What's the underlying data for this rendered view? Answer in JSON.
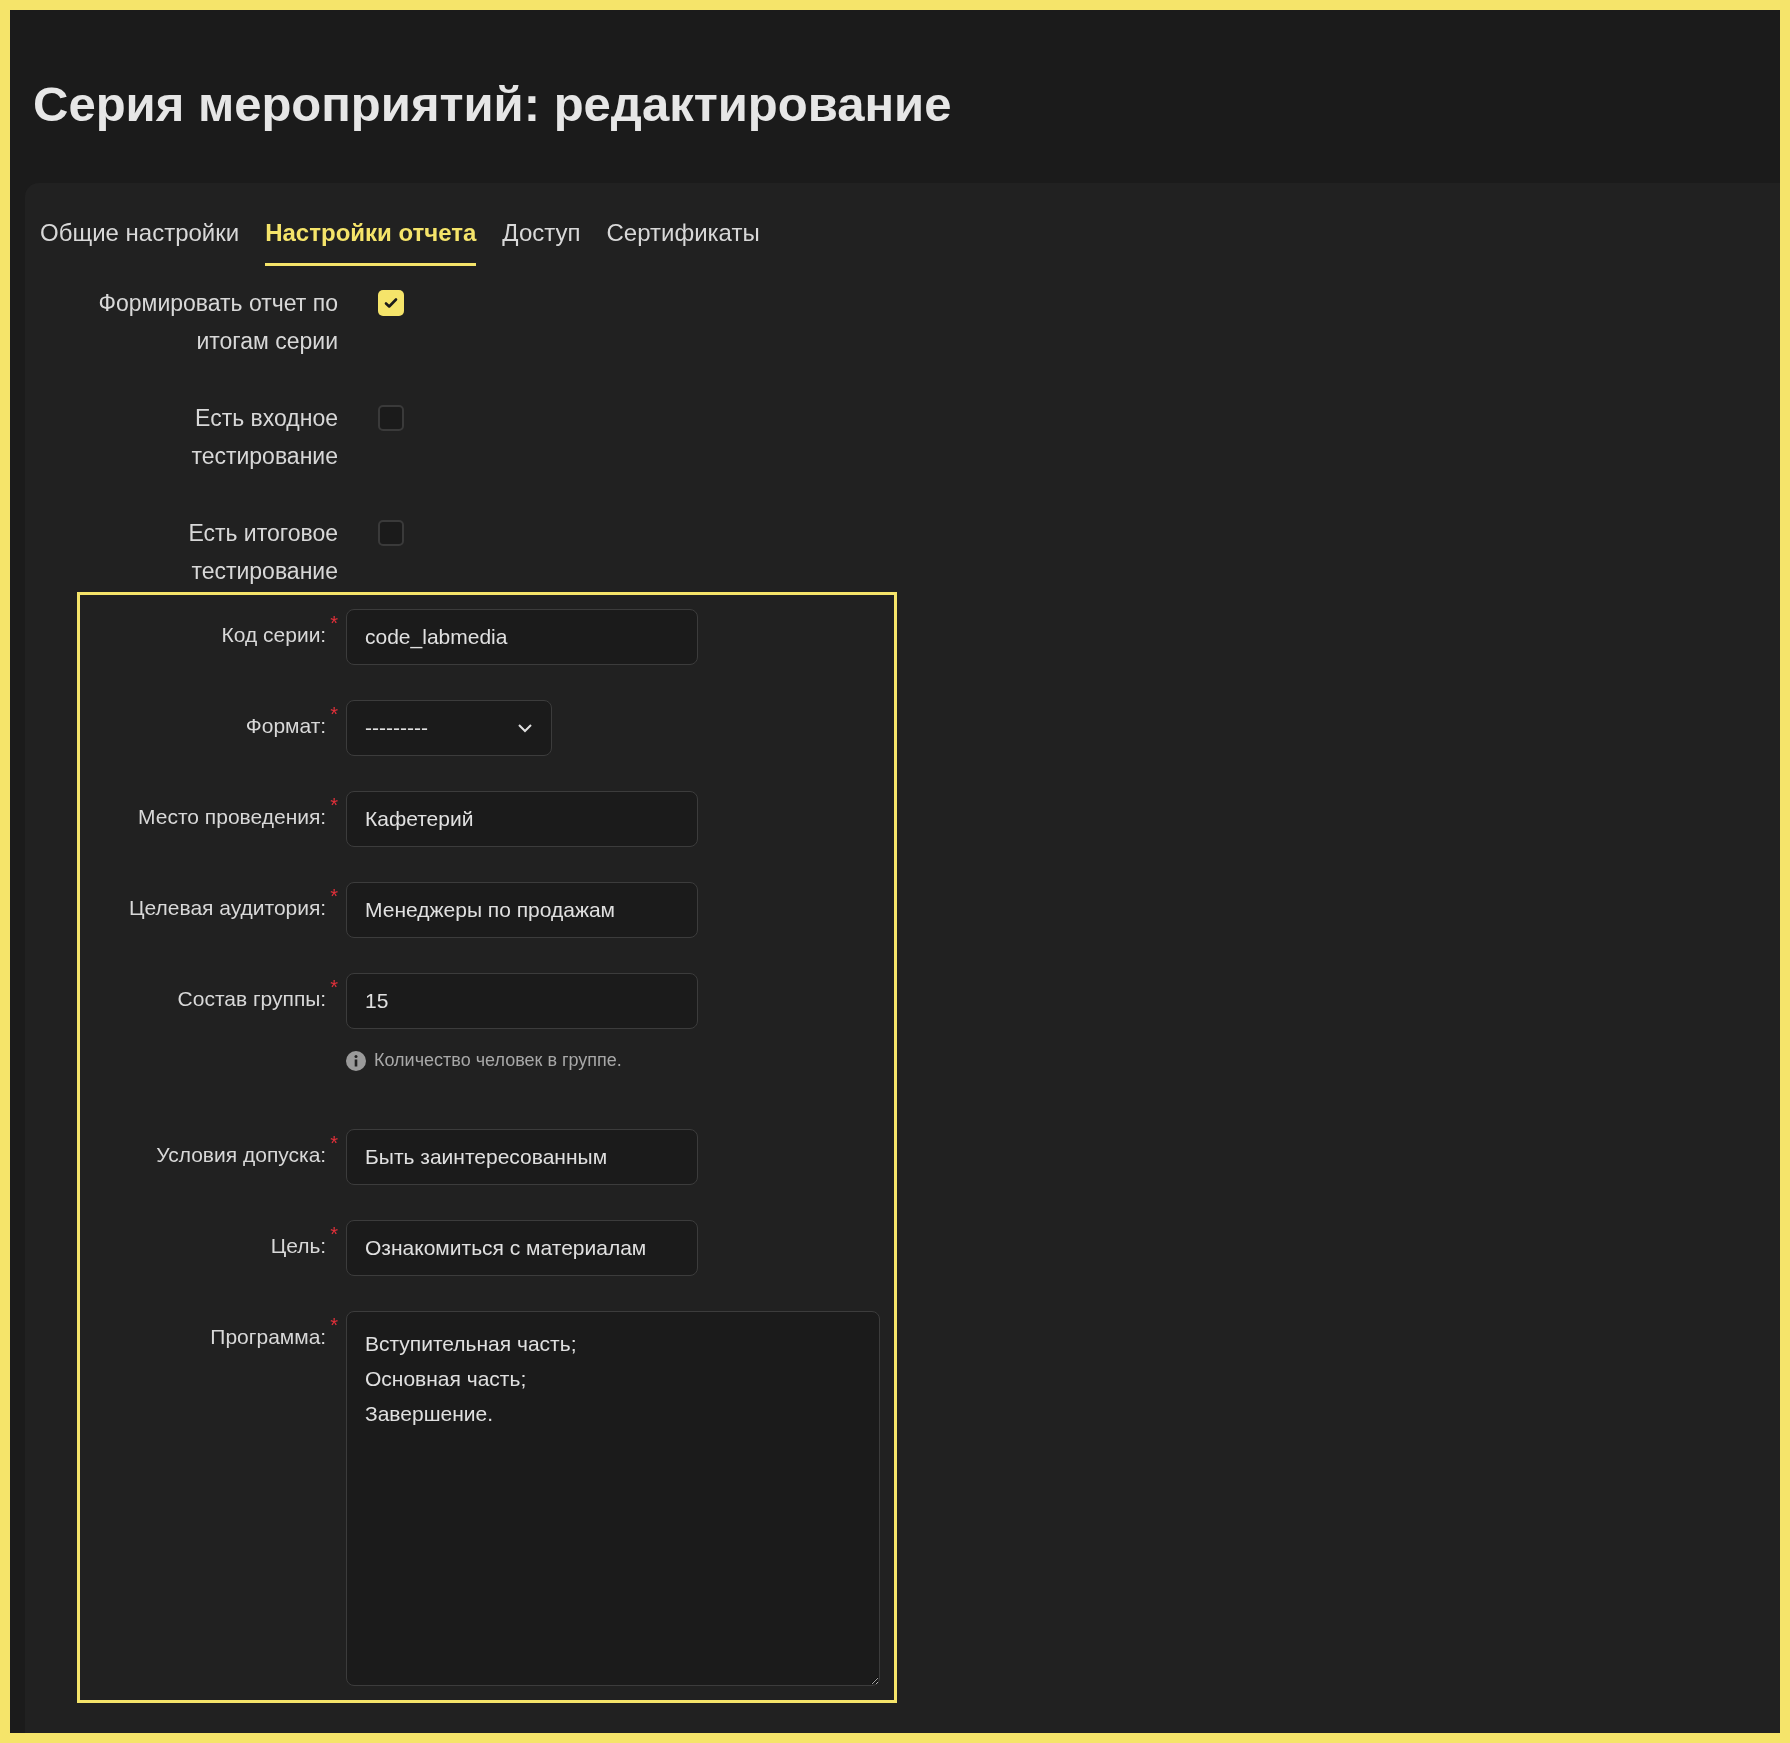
{
  "page": {
    "title": "Серия мероприятий: редактирование"
  },
  "tabs": [
    {
      "label": "Общие настройки",
      "selected": false
    },
    {
      "label": "Настройки отчета",
      "selected": true
    },
    {
      "label": "Доступ",
      "selected": false
    },
    {
      "label": "Сертификаты",
      "selected": false
    }
  ],
  "options": [
    {
      "label": "Формировать отчет по итогам серии",
      "checked": true
    },
    {
      "label": "Есть входное тестирование",
      "checked": false
    },
    {
      "label": "Есть итоговое тестирование",
      "checked": false
    }
  ],
  "form": {
    "highlighted": true,
    "fields": [
      {
        "kind": "text",
        "label": "Код серии:",
        "required_mark": "*",
        "value": "code_labmedia"
      },
      {
        "kind": "select",
        "label": "Формат:",
        "required_mark": "*",
        "value": "---------"
      },
      {
        "kind": "text",
        "label": "Место проведения:",
        "required_mark": "*",
        "value": "Кафетерий"
      },
      {
        "kind": "text",
        "label": "Целевая аудитория:",
        "required_mark": "*",
        "value": "Менеджеры по продажам"
      },
      {
        "kind": "text",
        "label": "Состав группы:",
        "required_mark": "*",
        "value": "15",
        "hint": "Количество человек в группе."
      },
      {
        "kind": "text",
        "label": "Условия допуска:",
        "required_mark": "*",
        "value": "Быть заинтересованным"
      },
      {
        "kind": "text",
        "label": "Цель:",
        "required_mark": "*",
        "value": "Ознакомиться с материалам"
      },
      {
        "kind": "textarea",
        "label": "Программа:",
        "required_mark": "*",
        "lines": [
          "Вступительная часть;",
          "Основная часть;",
          "Завершение."
        ]
      }
    ]
  }
}
